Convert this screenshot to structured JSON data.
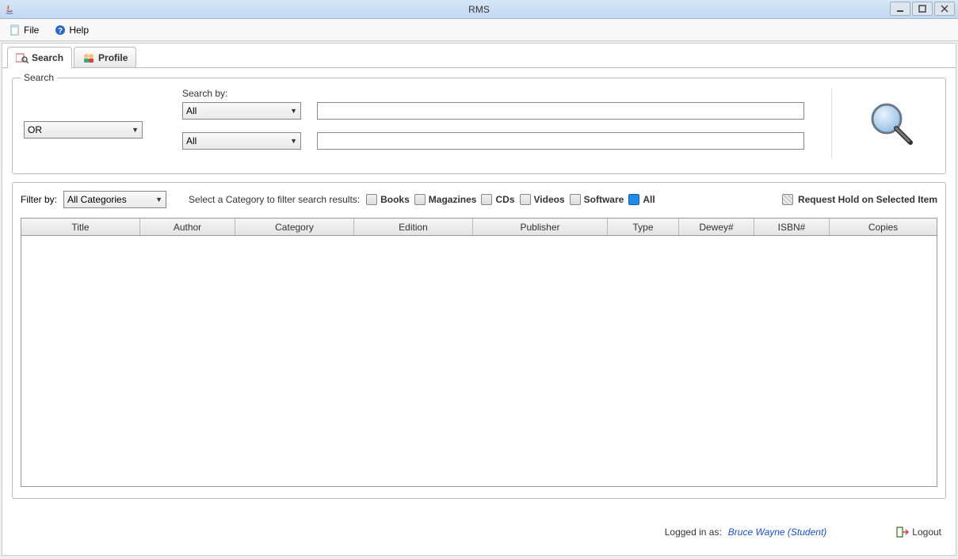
{
  "window": {
    "title": "RMS"
  },
  "menubar": {
    "file": "File",
    "help": "Help"
  },
  "tabs": {
    "search": "Search",
    "profile": "Profile"
  },
  "search_panel": {
    "legend": "Search",
    "search_by_label": "Search by:",
    "operator": "OR",
    "criteria1": "All",
    "criteria2": "All",
    "input1": "",
    "input2": ""
  },
  "filter": {
    "filter_by_label": "Filter by:",
    "filter_value": "All Categories",
    "select_category_label": "Select a Category to filter search results:",
    "categories": {
      "books": "Books",
      "magazines": "Magazines",
      "cds": "CDs",
      "videos": "Videos",
      "software": "Software",
      "all": "All"
    },
    "request_hold": "Request Hold on Selected Item"
  },
  "table": {
    "columns": [
      "Title",
      "Author",
      "Category",
      "Edition",
      "Publisher",
      "Type",
      "Dewey#",
      "ISBN#",
      "Copies"
    ]
  },
  "footer": {
    "logged_label": "Logged in as:",
    "user": "Bruce Wayne (Student)",
    "logout": "Logout"
  }
}
